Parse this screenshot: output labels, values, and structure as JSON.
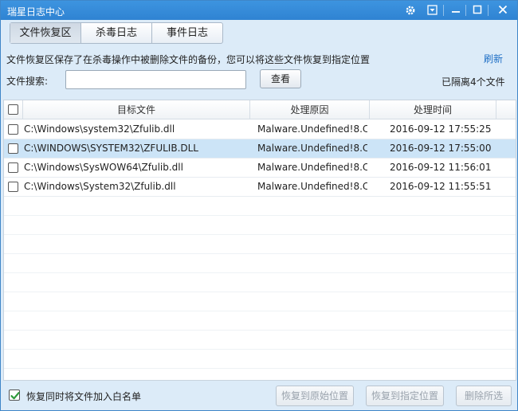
{
  "window": {
    "title": "瑞星日志中心",
    "controls": [
      "gear-icon",
      "skin-icon",
      "minimize-icon",
      "maximize-icon",
      "close-icon"
    ]
  },
  "tabs": [
    {
      "label": "文件恢复区",
      "active": true
    },
    {
      "label": "杀毒日志",
      "active": false
    },
    {
      "label": "事件日志",
      "active": false
    }
  ],
  "info": {
    "description": "文件恢复区保存了在杀毒操作中被删除文件的备份，您可以将这些文件恢复到指定位置",
    "refresh_label": "刷新"
  },
  "search": {
    "label": "文件搜索:",
    "value": "",
    "placeholder": "",
    "button_label": "查看",
    "count_text": "已隔离4个文件"
  },
  "table": {
    "headers": {
      "file": "目标文件",
      "reason": "处理原因",
      "time": "处理时间"
    },
    "rows": [
      {
        "file": "C:\\Windows\\system32\\Zfulib.dll",
        "reason": "Malware.Undefined!8.C",
        "time": "2016-09-12 17:55:25",
        "selected": false
      },
      {
        "file": "C:\\WINDOWS\\SYSTEM32\\ZFULIB.DLL",
        "reason": "Malware.Undefined!8.C",
        "time": "2016-09-12 17:55:00",
        "selected": true
      },
      {
        "file": "C:\\Windows\\SysWOW64\\Zfulib.dll",
        "reason": "Malware.Undefined!8.C",
        "time": "2016-09-12 11:56:01",
        "selected": false
      },
      {
        "file": "C:\\Windows\\System32\\Zfulib.dll",
        "reason": "Malware.Undefined!8.C",
        "time": "2016-09-12 11:55:51",
        "selected": false
      }
    ]
  },
  "footer": {
    "whitelist_label": "恢复同时将文件加入白名单",
    "whitelist_checked": true,
    "restore_original_label": "恢复到原始位置",
    "restore_custom_label": "恢复到指定位置",
    "delete_selected_label": "删除所选"
  },
  "colors": {
    "titlebar": "#3d94e0",
    "selected_row": "#cce4f7",
    "link": "#1f6fc5",
    "check_green": "#2e9a3a"
  }
}
